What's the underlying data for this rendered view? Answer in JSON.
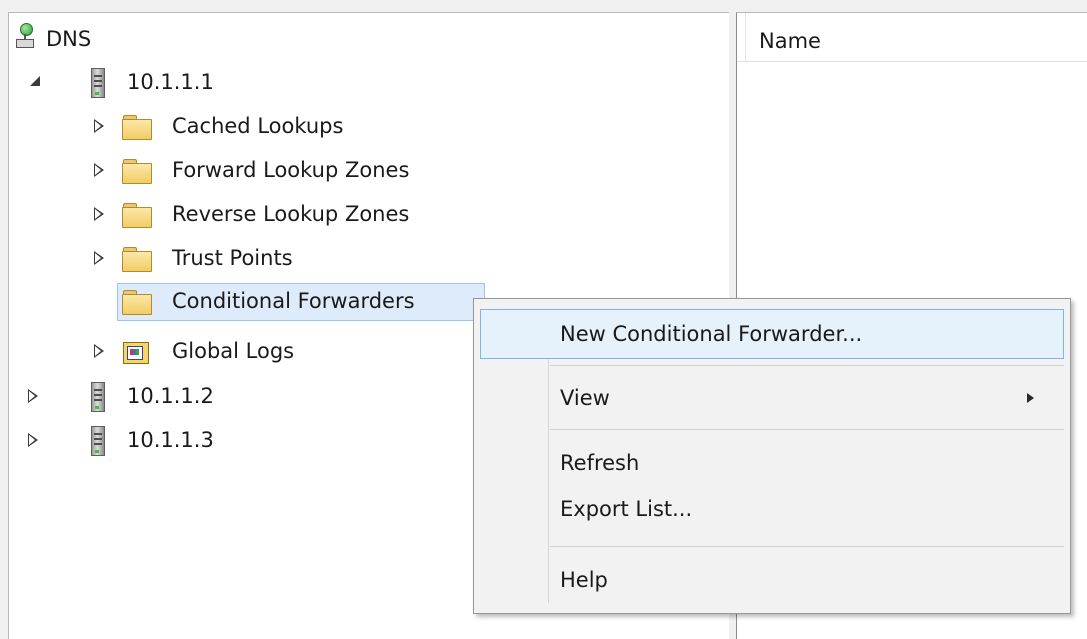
{
  "tree": {
    "root": {
      "label": "DNS",
      "icon": "dns-icon"
    },
    "nodes": [
      {
        "label": "10.1.1.1",
        "icon": "server-icon",
        "state": "expanded"
      },
      {
        "label": "Cached Lookups",
        "icon": "folder-icon",
        "state": "collapsed"
      },
      {
        "label": "Forward Lookup Zones",
        "icon": "folder-icon",
        "state": "collapsed"
      },
      {
        "label": "Reverse Lookup Zones",
        "icon": "folder-icon",
        "state": "collapsed"
      },
      {
        "label": "Trust Points",
        "icon": "folder-icon",
        "state": "collapsed"
      },
      {
        "label": "Conditional Forwarders",
        "icon": "folder-icon",
        "state": "selected"
      },
      {
        "label": "Global Logs",
        "icon": "log-icon",
        "state": "collapsed"
      },
      {
        "label": "10.1.1.2",
        "icon": "server-icon",
        "state": "collapsed"
      },
      {
        "label": "10.1.1.3",
        "icon": "server-icon",
        "state": "collapsed"
      }
    ]
  },
  "details": {
    "column_header": "Name"
  },
  "context_menu": {
    "items": [
      {
        "label": "New Conditional Forwarder...",
        "highlighted": true
      },
      {
        "label": "View",
        "submenu": true
      },
      {
        "label": "Refresh"
      },
      {
        "label": "Export List..."
      },
      {
        "label": "Help"
      }
    ]
  },
  "colors": {
    "selection_bg": "#ddebfb",
    "selection_border": "#9cc4ee",
    "menu_highlight_bg": "#e5f1fb",
    "menu_highlight_border": "#7fb4e8"
  }
}
